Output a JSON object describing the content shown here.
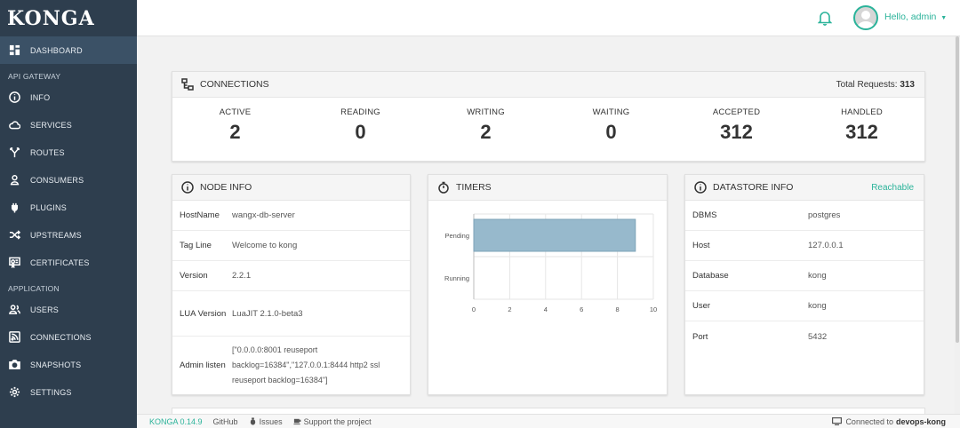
{
  "app": {
    "logo": "KONGA"
  },
  "sidebar": {
    "dashboard": "DASHBOARD",
    "sections": [
      {
        "title": "API GATEWAY",
        "items": [
          {
            "label": "INFO",
            "icon": "info-icon"
          },
          {
            "label": "SERVICES",
            "icon": "cloud-icon"
          },
          {
            "label": "ROUTES",
            "icon": "routes-icon"
          },
          {
            "label": "CONSUMERS",
            "icon": "user-icon"
          },
          {
            "label": "PLUGINS",
            "icon": "plug-icon"
          },
          {
            "label": "UPSTREAMS",
            "icon": "shuffle-icon"
          },
          {
            "label": "CERTIFICATES",
            "icon": "certificate-icon"
          }
        ]
      },
      {
        "title": "APPLICATION",
        "items": [
          {
            "label": "USERS",
            "icon": "users-icon"
          },
          {
            "label": "CONNECTIONS",
            "icon": "rss-icon"
          },
          {
            "label": "SNAPSHOTS",
            "icon": "camera-icon"
          },
          {
            "label": "SETTINGS",
            "icon": "gear-icon"
          }
        ]
      }
    ]
  },
  "header": {
    "greeting": "Hello, admin",
    "accent": "#2bb39a"
  },
  "connections": {
    "title": "CONNECTIONS",
    "total_label": "Total Requests:",
    "total_value": "313",
    "stats": [
      {
        "label": "ACTIVE",
        "value": "2"
      },
      {
        "label": "READING",
        "value": "0"
      },
      {
        "label": "WRITING",
        "value": "2"
      },
      {
        "label": "WAITING",
        "value": "0"
      },
      {
        "label": "ACCEPTED",
        "value": "312"
      },
      {
        "label": "HANDLED",
        "value": "312"
      }
    ]
  },
  "node_info": {
    "title": "NODE INFO",
    "rows": [
      {
        "key": "HostName",
        "value": "wangx-db-server"
      },
      {
        "key": "Tag Line",
        "value": "Welcome to kong"
      },
      {
        "key": "Version",
        "value": "2.2.1"
      },
      {
        "key": "LUA Version",
        "value": "LuaJIT 2.1.0-beta3"
      },
      {
        "key": "Admin listen",
        "value": "[\"0.0.0.0:8001 reuseport backlog=16384\",\"127.0.0.1:8444 http2 ssl reuseport backlog=16384\"]"
      }
    ]
  },
  "timers": {
    "title": "TIMERS",
    "chart_data": {
      "type": "bar",
      "orientation": "horizontal",
      "categories": [
        "Pending",
        "Running"
      ],
      "values": [
        9,
        0
      ],
      "xlim": [
        0,
        10
      ],
      "xticks": [
        0,
        2,
        4,
        6,
        8,
        10
      ],
      "grid": true,
      "bar_color": "#97b9cc"
    }
  },
  "datastore": {
    "title": "DATASTORE INFO",
    "status": "Reachable",
    "rows": [
      {
        "key": "DBMS",
        "value": "postgres"
      },
      {
        "key": "Host",
        "value": "127.0.0.1"
      },
      {
        "key": "Database",
        "value": "kong"
      },
      {
        "key": "User",
        "value": "kong"
      },
      {
        "key": "Port",
        "value": "5432"
      }
    ]
  },
  "footer": {
    "version": "KONGA 0.14.9",
    "github": "GitHub",
    "issues": "Issues",
    "support": "Support the project",
    "connected_label": "Connected to",
    "connected_name": "devops-kong"
  }
}
